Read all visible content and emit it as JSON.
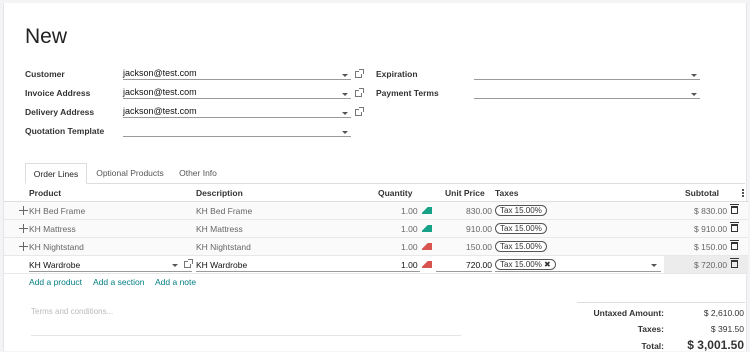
{
  "form": {
    "title": "New",
    "customer": {
      "label": "Customer",
      "value": "jackson@test.com"
    },
    "invoice_address": {
      "label": "Invoice Address",
      "value": "jackson@test.com"
    },
    "delivery_address": {
      "label": "Delivery Address",
      "value": "jackson@test.com"
    },
    "quotation_template": {
      "label": "Quotation Template",
      "value": ""
    },
    "expiration": {
      "label": "Expiration",
      "value": ""
    },
    "payment_terms": {
      "label": "Payment Terms",
      "value": ""
    }
  },
  "tabs": [
    {
      "label": "Order Lines",
      "active": true
    },
    {
      "label": "Optional Products",
      "active": false
    },
    {
      "label": "Other Info",
      "active": false
    }
  ],
  "columns": {
    "product": "Product",
    "description": "Description",
    "quantity": "Quantity",
    "unit_price": "Unit Price",
    "taxes": "Taxes",
    "subtotal": "Subtotal"
  },
  "lines": [
    {
      "product": "KH Bed Frame",
      "description": "KH Bed Frame",
      "quantity": "1.00",
      "forecast": "green",
      "unit_price": "830.00",
      "tax": "Tax 15.00%",
      "subtotal": "$ 830.00"
    },
    {
      "product": "KH Mattress",
      "description": "KH Mattress",
      "quantity": "1.00",
      "forecast": "green",
      "unit_price": "910.00",
      "tax": "Tax 15.00%",
      "subtotal": "$ 910.00"
    },
    {
      "product": "KH Nightstand",
      "description": "KH Nightstand",
      "quantity": "1.00",
      "forecast": "red",
      "unit_price": "150.00",
      "tax": "Tax 15.00%",
      "subtotal": "$ 150.00"
    },
    {
      "product": "KH Wardrobe",
      "description": "KH Wardrobe",
      "quantity": "1.00",
      "forecast": "red",
      "unit_price": "720.00",
      "tax": "Tax 15.00% ✖",
      "subtotal": "$ 720.00"
    }
  ],
  "actions": {
    "add_product": "Add a product",
    "add_section": "Add a section",
    "add_note": "Add a note"
  },
  "terms_placeholder": "Terms and conditions...",
  "totals": {
    "untaxed_label": "Untaxed Amount:",
    "untaxed_value": "$ 2,610.00",
    "taxes_label": "Taxes:",
    "taxes_value": "$ 391.50",
    "total_label": "Total:",
    "total_value": "$ 3,001.50"
  },
  "colors": {
    "accent": "#017e84",
    "forecast_green": "#17a187",
    "forecast_red": "#d9534f"
  }
}
